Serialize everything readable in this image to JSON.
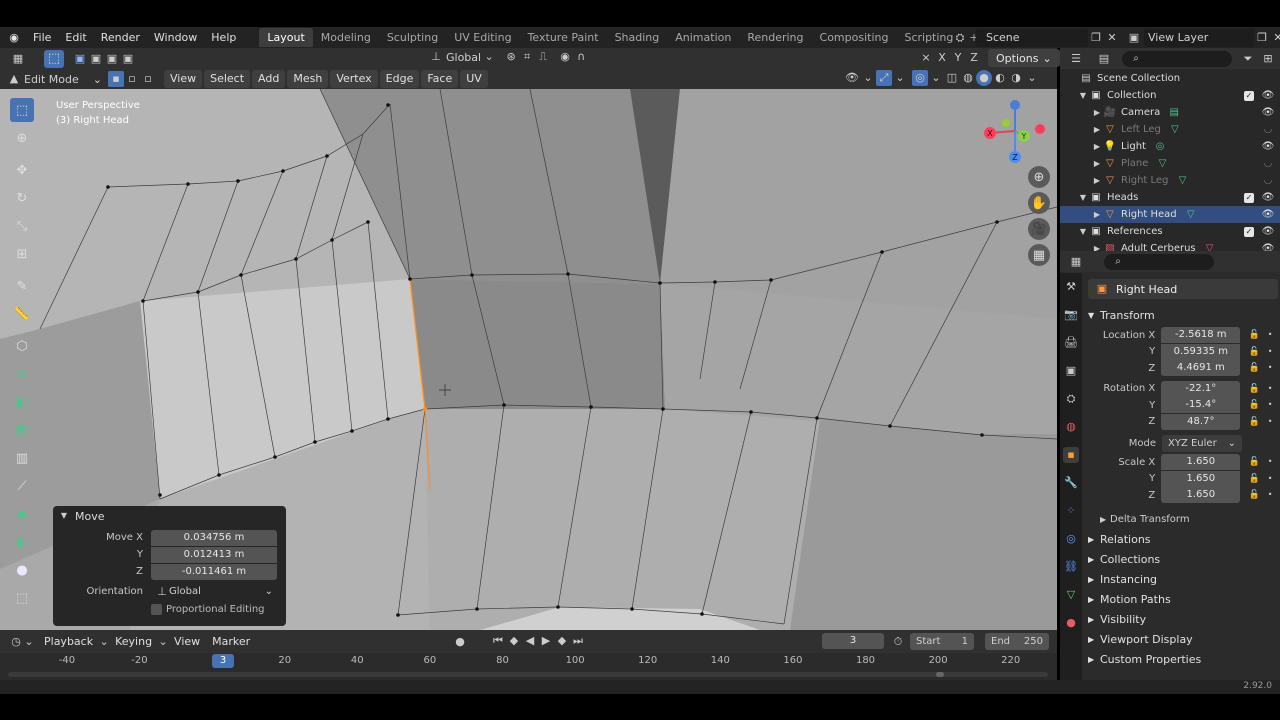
{
  "topbar": {
    "menus": [
      "File",
      "Edit",
      "Render",
      "Window",
      "Help"
    ],
    "workspaces": [
      "Layout",
      "Modeling",
      "Sculpting",
      "UV Editing",
      "Texture Paint",
      "Shading",
      "Animation",
      "Rendering",
      "Compositing",
      "Scripting"
    ],
    "active_workspace": "Layout",
    "add_workspace": "+",
    "scene": "Scene",
    "view_layer": "View Layer"
  },
  "tool_header": {
    "orientation": "Global",
    "options": "Options"
  },
  "viewport_header": {
    "mode": "Edit Mode",
    "menus": [
      "View",
      "Select",
      "Add",
      "Mesh",
      "Vertex",
      "Edge",
      "Face",
      "UV"
    ]
  },
  "viewport": {
    "perspective": "User Perspective",
    "object_label": "(3) Right Head",
    "gizmo": {
      "x": "X",
      "y": "Y",
      "z": "Z"
    }
  },
  "operator_panel": {
    "title": "Move",
    "move_x_label": "Move X",
    "move_x": "0.034756 m",
    "y_label": "Y",
    "move_y": "0.012413 m",
    "z_label": "Z",
    "move_z": "-0.011461 m",
    "orientation_label": "Orientation",
    "orientation": "Global",
    "proportional": "Proportional Editing"
  },
  "outliner": {
    "root": "Scene Collection",
    "rows": [
      {
        "label": "Collection",
        "type": "collection",
        "indent": 0,
        "check": true
      },
      {
        "label": "Camera",
        "type": "camera",
        "indent": 1,
        "eye": true
      },
      {
        "label": "Left Leg",
        "type": "mesh",
        "indent": 1,
        "eye": false,
        "dim": true
      },
      {
        "label": "Light",
        "type": "light",
        "indent": 1,
        "eye": true
      },
      {
        "label": "Plane",
        "type": "mesh",
        "indent": 1,
        "eye": false,
        "dim": true
      },
      {
        "label": "Right Leg",
        "type": "mesh",
        "indent": 1,
        "eye": false,
        "dim": true
      },
      {
        "label": "Heads",
        "type": "collection",
        "indent": 0,
        "check": true
      },
      {
        "label": "Right Head",
        "type": "mesh",
        "indent": 1,
        "eye": true,
        "selected": true
      },
      {
        "label": "References",
        "type": "collection",
        "indent": 0,
        "check": true
      },
      {
        "label": "Adult Cerberus",
        "type": "image",
        "indent": 1,
        "eye": true
      }
    ]
  },
  "properties": {
    "object_name": "Right Head",
    "transform_title": "Transform",
    "location_label": "Location X",
    "location": [
      "-2.5618 m",
      "0.59335 m",
      "4.4691 m"
    ],
    "rotation_label": "Rotation X",
    "rotation": [
      "-22.1°",
      "-15.4°",
      "48.7°"
    ],
    "mode_label": "Mode",
    "mode": "XYZ Euler",
    "scale_label": "Scale X",
    "scale": [
      "1.650",
      "1.650",
      "1.650"
    ],
    "axis_y": "Y",
    "axis_z": "Z",
    "delta_transform": "Delta Transform",
    "sections": [
      "Relations",
      "Collections",
      "Instancing",
      "Motion Paths",
      "Visibility",
      "Viewport Display",
      "Custom Properties"
    ]
  },
  "timeline": {
    "menus": [
      "Playback",
      "Keying",
      "View",
      "Marker"
    ],
    "current_frame": "3",
    "start_label": "Start",
    "start": "1",
    "end_label": "End",
    "end": "250",
    "ticks": [
      "-40",
      "-20",
      "20",
      "40",
      "60",
      "80",
      "100",
      "120",
      "140",
      "160",
      "180",
      "200",
      "220"
    ],
    "playhead": "3"
  },
  "status": {
    "version": "2.92.0"
  },
  "colors": {
    "accent": "#4772b3",
    "selected_row": "#334d80",
    "edge_highlight": "#ff8c1a"
  }
}
